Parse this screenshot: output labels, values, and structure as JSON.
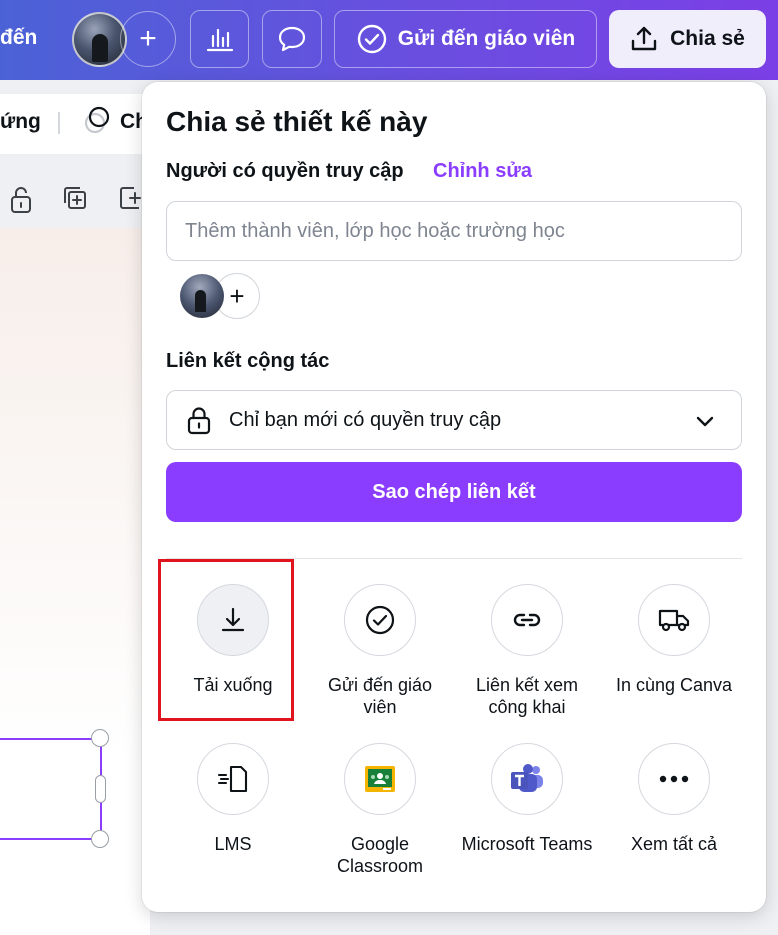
{
  "topbar": {
    "project_name_partial": "đến",
    "add_label": "+",
    "send_teacher_label": "Gửi đến giáo viên",
    "share_label": "Chia sẻ",
    "gradient_start": "#4b62d6",
    "gradient_end": "#7b3fe6"
  },
  "toolbar2": {
    "text_partial": "ứng",
    "ch_partial": "Ch"
  },
  "share_panel": {
    "title": "Chia sẻ thiết kế này",
    "access_label": "Người có quyền truy cập",
    "edit_link": "Chỉnh sửa",
    "member_input_placeholder": "Thêm thành viên, lớp học hoặc trường học",
    "add_member_symbol": "+",
    "collab_label": "Liên kết cộng tác",
    "collab_option": "Chỉ bạn mới có quyền truy cập",
    "copy_link_label": "Sao chép liên kết",
    "accent_color": "#8b3dff",
    "options": [
      {
        "label": "Tải xuống",
        "icon": "download-icon"
      },
      {
        "label": "Gửi đến giáo viên",
        "icon": "check-circle-icon"
      },
      {
        "label": "Liên kết xem công khai",
        "icon": "link-icon"
      },
      {
        "label": "In cùng Canva",
        "icon": "truck-icon"
      },
      {
        "label": "LMS",
        "icon": "lms-icon"
      },
      {
        "label": "Google Classroom",
        "icon": "google-classroom-icon"
      },
      {
        "label": "Microsoft Teams",
        "icon": "microsoft-teams-icon"
      },
      {
        "label": "Xem tất cả",
        "icon": "more-icon"
      }
    ]
  }
}
